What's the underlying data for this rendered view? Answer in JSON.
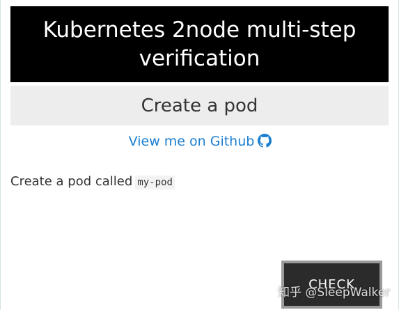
{
  "header": {
    "title": "Kubernetes 2node multi-step verification"
  },
  "subheader": {
    "title": "Create a pod"
  },
  "github_link": {
    "label": "View me on Github",
    "icon": "github-icon"
  },
  "task": {
    "text": "Create a pod called",
    "code": "my-pod"
  },
  "actions": {
    "check_label": "CHECK"
  },
  "watermark": {
    "text": "知乎 @SleepWalker"
  },
  "colors": {
    "header_bg": "#000000",
    "subheader_bg": "#ededed",
    "link": "#1b7fd1",
    "button_bg": "#2b2b2b"
  }
}
